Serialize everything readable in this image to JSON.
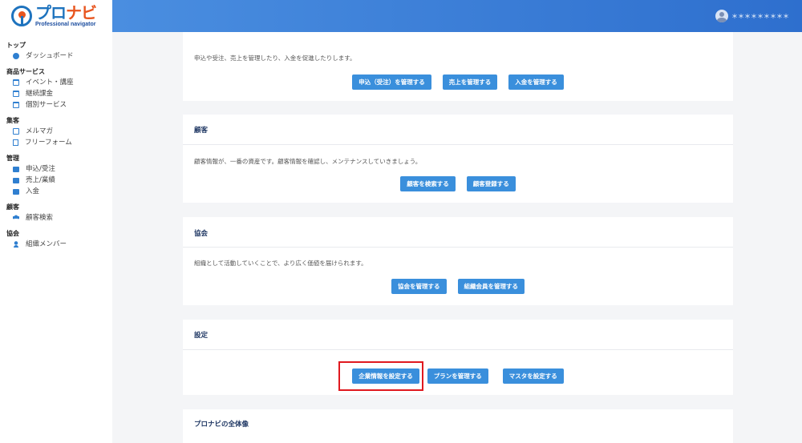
{
  "logo": {
    "main_a": "プロ",
    "main_b": "ナビ",
    "sub": "Professional navigator"
  },
  "sidebar": {
    "sections": [
      {
        "title": "トップ",
        "items": [
          {
            "label": "ダッシュボード",
            "icon": "dashboard-icon"
          }
        ]
      },
      {
        "title": "商品サービス",
        "items": [
          {
            "label": "イベント・講座",
            "icon": "calendar-icon"
          },
          {
            "label": "継続課金",
            "icon": "calendar-icon"
          },
          {
            "label": "個別サービス",
            "icon": "calendar-icon"
          }
        ]
      },
      {
        "title": "集客",
        "items": [
          {
            "label": "メルマガ",
            "icon": "mail-icon"
          },
          {
            "label": "フリーフォーム",
            "icon": "form-icon"
          }
        ]
      },
      {
        "title": "管理",
        "items": [
          {
            "label": "申込/受注",
            "icon": "briefcase-icon"
          },
          {
            "label": "売上/業績",
            "icon": "briefcase-icon"
          },
          {
            "label": "入金",
            "icon": "briefcase-icon"
          }
        ]
      },
      {
        "title": "顧客",
        "items": [
          {
            "label": "顧客検索",
            "icon": "users-icon"
          }
        ]
      },
      {
        "title": "協会",
        "items": [
          {
            "label": "組織メンバー",
            "icon": "user-icon"
          }
        ]
      }
    ]
  },
  "header": {
    "user_name": "＊＊＊＊＊＊＊＊＊"
  },
  "cards": {
    "management": {
      "desc": "申込や受注、売上を管理したり、入金を促進したりします。",
      "buttons": [
        "申込（受注）を管理する",
        "売上を管理する",
        "入金を管理する"
      ]
    },
    "customers": {
      "title": "顧客",
      "desc": "顧客情報が、一番の資産です。顧客情報を確認し、メンテナンスしていきましょう。",
      "buttons": [
        "顧客を検索する",
        "顧客登録する"
      ]
    },
    "association": {
      "title": "協会",
      "desc": "組織として活動していくことで、より広く価値を届けられます。",
      "buttons": [
        "協会を管理する",
        "組織会員を管理する"
      ]
    },
    "settings": {
      "title": "設定",
      "buttons": [
        "企業情報を設定する",
        "プランを管理する",
        "マスタを設定する"
      ]
    },
    "overview": {
      "title": "プロナビの全体像"
    }
  },
  "colors": {
    "header_start": "#4a8ee0",
    "header_end": "#2e6fce",
    "button": "#3a8fdc",
    "highlight": "#e0191f",
    "title": "#203864"
  }
}
